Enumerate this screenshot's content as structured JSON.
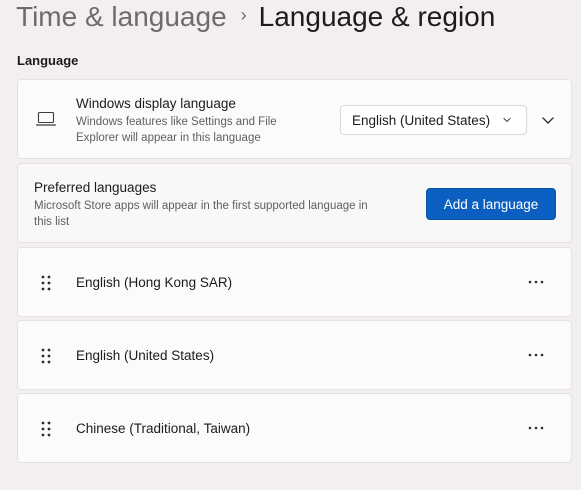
{
  "breadcrumb": {
    "parent": "Time & language",
    "separator": "›",
    "current": "Language & region"
  },
  "section": {
    "title": "Language"
  },
  "display_language": {
    "icon": "laptop-icon",
    "title": "Windows display language",
    "description_line1": "Windows features like Settings and File",
    "description_line2": "Explorer will appear in this language",
    "selected_value": "English (United States)"
  },
  "preferred_languages": {
    "title": "Preferred languages",
    "description_line1": "Microsoft Store apps will appear in the first supported language in",
    "description_line2": "this list",
    "add_button_label": "Add a language"
  },
  "languages": [
    {
      "label": "English (Hong Kong SAR)"
    },
    {
      "label": "English (United States)"
    },
    {
      "label": "Chinese (Traditional, Taiwan)"
    }
  ],
  "colors": {
    "accent": "#0a5fc0",
    "background": "#f3eeef",
    "card": "#fbfbfb"
  }
}
